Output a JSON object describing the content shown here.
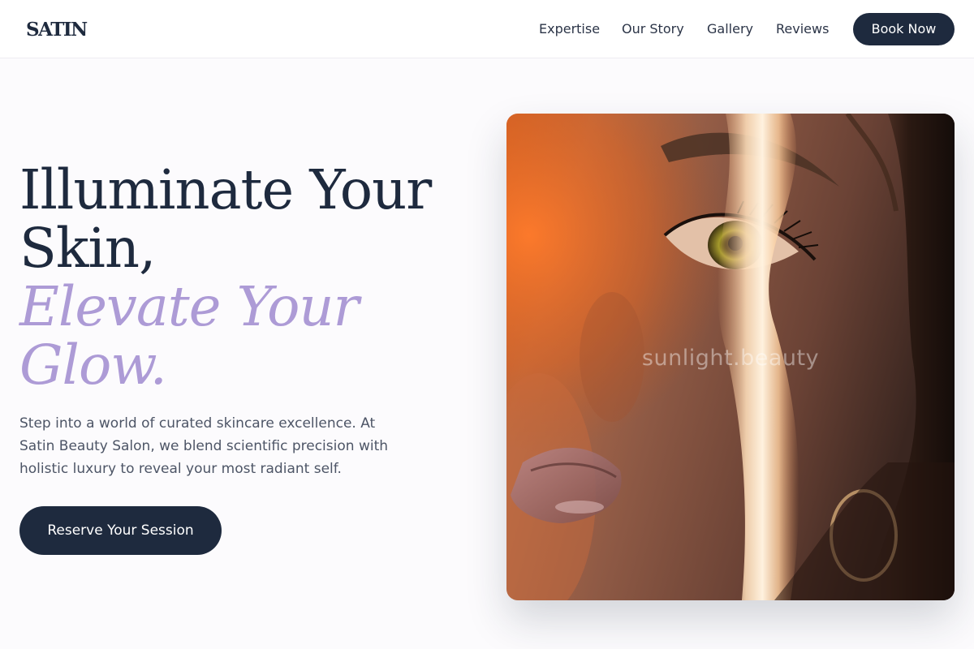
{
  "brand": {
    "logo": "SATIN",
    "primary_color": "#1e2a3e",
    "accent_color": "#ad9bd6"
  },
  "nav": {
    "links": [
      "Expertise",
      "Our Story",
      "Gallery",
      "Reviews"
    ],
    "book_label": "Book Now"
  },
  "hero": {
    "headline_lines": [
      "Illuminate Your",
      "Skin,"
    ],
    "accent_lines": [
      "Elevate Your",
      "Glow."
    ],
    "description": "Step into a world of curated skincare excellence. At Satin Beauty Salon, we blend scientific precision with holistic luxury to reveal your most radiant self.",
    "cta_label": "Reserve Your Session",
    "image": {
      "subject": "close-up portrait of a woman's face lit by a streak of sunlight",
      "watermark": "sunlight.beauty"
    }
  }
}
